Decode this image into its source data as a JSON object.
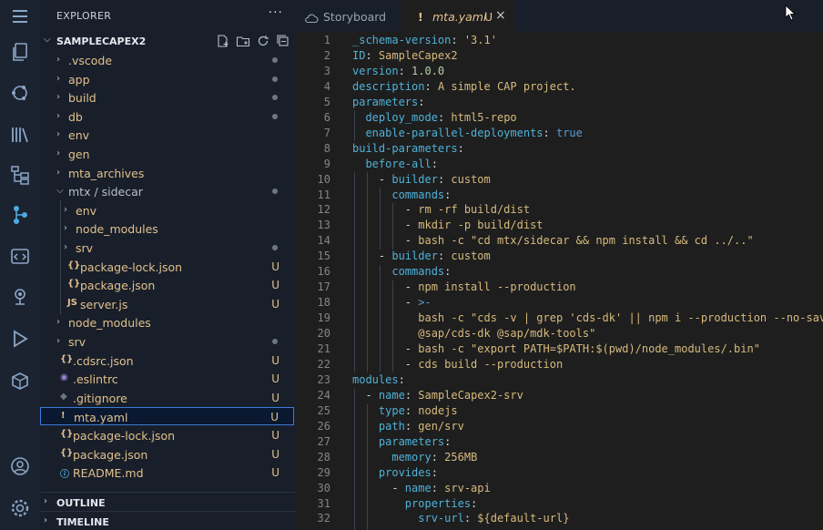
{
  "explorer": {
    "title": "EXPLORER",
    "more": "···",
    "root": "SAMPLECAPEX2",
    "items": [
      {
        "label": ".vscode",
        "type": "folder",
        "depth": 0,
        "open": false,
        "status": "dot",
        "color": "#e2c08d"
      },
      {
        "label": "app",
        "type": "folder",
        "depth": 0,
        "open": false,
        "status": "dot",
        "color": "#e2c08d"
      },
      {
        "label": "build",
        "type": "folder",
        "depth": 0,
        "open": false,
        "status": "dot",
        "color": "#e2c08d"
      },
      {
        "label": "db",
        "type": "folder",
        "depth": 0,
        "open": false,
        "status": "dot",
        "color": "#e2c08d"
      },
      {
        "label": "env",
        "type": "folder",
        "depth": 0,
        "open": false,
        "status": "",
        "color": "#e2c08d"
      },
      {
        "label": "gen",
        "type": "folder",
        "depth": 0,
        "open": false,
        "status": "",
        "color": "#e2c08d"
      },
      {
        "label": "mta_archives",
        "type": "folder",
        "depth": 0,
        "open": false,
        "status": "",
        "color": "#e2c08d"
      },
      {
        "label": "mtx / sidecar",
        "type": "folder",
        "depth": 0,
        "open": true,
        "status": "dot",
        "color": "#b8bfca"
      },
      {
        "label": "env",
        "type": "folder",
        "depth": 1,
        "open": false,
        "status": "",
        "color": "#e2c08d"
      },
      {
        "label": "node_modules",
        "type": "folder",
        "depth": 1,
        "open": false,
        "status": "",
        "color": "#e2c08d"
      },
      {
        "label": "srv",
        "type": "folder",
        "depth": 1,
        "open": false,
        "status": "dot",
        "color": "#e2c08d"
      },
      {
        "label": "package-lock.json",
        "type": "json",
        "depth": 1,
        "icon": "{}",
        "status": "U",
        "color": "#e2c08d"
      },
      {
        "label": "package.json",
        "type": "json",
        "depth": 1,
        "icon": "{}",
        "status": "U",
        "color": "#e2c08d"
      },
      {
        "label": "server.js",
        "type": "js",
        "depth": 1,
        "icon": "JS",
        "status": "U",
        "color": "#e2c08d"
      },
      {
        "label": "node_modules",
        "type": "folder",
        "depth": 0,
        "open": false,
        "status": "",
        "color": "#e2c08d"
      },
      {
        "label": "srv",
        "type": "folder",
        "depth": 0,
        "open": false,
        "status": "dot",
        "color": "#e2c08d"
      },
      {
        "label": ".cdsrc.json",
        "type": "json",
        "depth": 0,
        "icon": "{}",
        "status": "U",
        "color": "#e2c08d"
      },
      {
        "label": ".eslintrc",
        "type": "eslint",
        "depth": 0,
        "icon": "◉",
        "status": "U",
        "color": "#e2c08d"
      },
      {
        "label": ".gitignore",
        "type": "git",
        "depth": 0,
        "icon": "◆",
        "status": "U",
        "color": "#e2c08d"
      },
      {
        "label": "mta.yaml",
        "type": "yaml",
        "depth": 0,
        "icon": "!",
        "status": "U",
        "color": "#e2c08d",
        "selected": true
      },
      {
        "label": "package-lock.json",
        "type": "json",
        "depth": 0,
        "icon": "{}",
        "status": "U",
        "color": "#e2c08d"
      },
      {
        "label": "package.json",
        "type": "json",
        "depth": 0,
        "icon": "{}",
        "status": "U",
        "color": "#e2c08d"
      },
      {
        "label": "README.md",
        "type": "info",
        "depth": 0,
        "icon": "ⓘ",
        "status": "U",
        "color": "#e2c08d"
      }
    ],
    "outline": "OUTLINE",
    "timeline": "TIMELINE"
  },
  "tabs": [
    {
      "label": "Storyboard",
      "active": false,
      "icon": "cloud-icon"
    },
    {
      "label": "mta.yaml",
      "active": true,
      "icon": "!",
      "status": "U",
      "close": "×"
    }
  ],
  "editor": {
    "lines": [
      {
        "n": "1",
        "parts": [
          [
            "k",
            "_schema-version"
          ],
          [
            "p",
            ": "
          ],
          [
            "s",
            "'3.1'"
          ]
        ]
      },
      {
        "n": "2",
        "parts": [
          [
            "k",
            "ID"
          ],
          [
            "p",
            ": "
          ],
          [
            "t",
            "SampleCapex2"
          ]
        ]
      },
      {
        "n": "3",
        "parts": [
          [
            "k",
            "version"
          ],
          [
            "p",
            ": "
          ],
          [
            "n",
            "1.0.0"
          ]
        ]
      },
      {
        "n": "4",
        "parts": [
          [
            "k",
            "description"
          ],
          [
            "p",
            ": "
          ],
          [
            "t",
            "A simple CAP project."
          ]
        ]
      },
      {
        "n": "5",
        "parts": [
          [
            "k",
            "parameters"
          ],
          [
            "p",
            ":"
          ]
        ]
      },
      {
        "n": "6",
        "parts": [
          [
            "p",
            "  "
          ],
          [
            "k",
            "deploy_mode"
          ],
          [
            "p",
            ": "
          ],
          [
            "t",
            "html5-repo"
          ]
        ]
      },
      {
        "n": "7",
        "parts": [
          [
            "p",
            "  "
          ],
          [
            "k",
            "enable-parallel-deployments"
          ],
          [
            "p",
            ": "
          ],
          [
            "b",
            "true"
          ]
        ]
      },
      {
        "n": "8",
        "parts": [
          [
            "k",
            "build-parameters"
          ],
          [
            "p",
            ":"
          ]
        ]
      },
      {
        "n": "9",
        "parts": [
          [
            "p",
            "  "
          ],
          [
            "k",
            "before-all"
          ],
          [
            "p",
            ":"
          ]
        ]
      },
      {
        "n": "10",
        "parts": [
          [
            "p",
            "    - "
          ],
          [
            "k",
            "builder"
          ],
          [
            "p",
            ": "
          ],
          [
            "t",
            "custom"
          ]
        ]
      },
      {
        "n": "11",
        "parts": [
          [
            "p",
            "      "
          ],
          [
            "k",
            "commands"
          ],
          [
            "p",
            ":"
          ]
        ]
      },
      {
        "n": "12",
        "parts": [
          [
            "p",
            "        - "
          ],
          [
            "t",
            "rm -rf build/dist"
          ]
        ]
      },
      {
        "n": "13",
        "parts": [
          [
            "p",
            "        - "
          ],
          [
            "t",
            "mkdir -p build/dist"
          ]
        ]
      },
      {
        "n": "14",
        "parts": [
          [
            "p",
            "        - "
          ],
          [
            "t",
            "bash -c \"cd mtx/sidecar && npm install && cd ../..\""
          ]
        ]
      },
      {
        "n": "15",
        "parts": [
          [
            "p",
            "    - "
          ],
          [
            "k",
            "builder"
          ],
          [
            "p",
            ": "
          ],
          [
            "t",
            "custom"
          ]
        ]
      },
      {
        "n": "16",
        "parts": [
          [
            "p",
            "      "
          ],
          [
            "k",
            "commands"
          ],
          [
            "p",
            ":"
          ]
        ]
      },
      {
        "n": "17",
        "parts": [
          [
            "p",
            "        - "
          ],
          [
            "t",
            "npm install --production"
          ]
        ]
      },
      {
        "n": "18",
        "parts": [
          [
            "p",
            "        - "
          ],
          [
            "b",
            ">-"
          ]
        ]
      },
      {
        "n": "19",
        "parts": [
          [
            "p",
            "          "
          ],
          [
            "t",
            "bash -c \"cds -v | grep 'cds-dk' || npm i --production --no-save"
          ]
        ]
      },
      {
        "n": "20",
        "parts": [
          [
            "p",
            "          "
          ],
          [
            "t",
            "@sap/cds-dk @sap/mdk-tools\""
          ]
        ]
      },
      {
        "n": "21",
        "parts": [
          [
            "p",
            "        - "
          ],
          [
            "t",
            "bash -c \"export PATH=$PATH:$(pwd)/node_modules/.bin\""
          ]
        ]
      },
      {
        "n": "22",
        "parts": [
          [
            "p",
            "        - "
          ],
          [
            "t",
            "cds build --production"
          ]
        ]
      },
      {
        "n": "23",
        "parts": [
          [
            "k",
            "modules"
          ],
          [
            "p",
            ":"
          ]
        ]
      },
      {
        "n": "24",
        "parts": [
          [
            "p",
            "  - "
          ],
          [
            "k",
            "name"
          ],
          [
            "p",
            ": "
          ],
          [
            "t",
            "SampleCapex2-srv"
          ]
        ]
      },
      {
        "n": "25",
        "parts": [
          [
            "p",
            "    "
          ],
          [
            "k",
            "type"
          ],
          [
            "p",
            ": "
          ],
          [
            "t",
            "nodejs"
          ]
        ]
      },
      {
        "n": "26",
        "parts": [
          [
            "p",
            "    "
          ],
          [
            "k",
            "path"
          ],
          [
            "p",
            ": "
          ],
          [
            "t",
            "gen/srv"
          ]
        ]
      },
      {
        "n": "27",
        "parts": [
          [
            "p",
            "    "
          ],
          [
            "k",
            "parameters"
          ],
          [
            "p",
            ":"
          ]
        ]
      },
      {
        "n": "28",
        "parts": [
          [
            "p",
            "      "
          ],
          [
            "k",
            "memory"
          ],
          [
            "p",
            ": "
          ],
          [
            "t",
            "256MB"
          ]
        ]
      },
      {
        "n": "29",
        "parts": [
          [
            "p",
            "    "
          ],
          [
            "k",
            "provides"
          ],
          [
            "p",
            ":"
          ]
        ]
      },
      {
        "n": "30",
        "parts": [
          [
            "p",
            "      - "
          ],
          [
            "k",
            "name"
          ],
          [
            "p",
            ": "
          ],
          [
            "t",
            "srv-api"
          ]
        ]
      },
      {
        "n": "31",
        "parts": [
          [
            "p",
            "        "
          ],
          [
            "k",
            "properties"
          ],
          [
            "p",
            ":"
          ]
        ]
      },
      {
        "n": "32",
        "parts": [
          [
            "p",
            "          "
          ],
          [
            "k",
            "srv-url"
          ],
          [
            "p",
            ": "
          ],
          [
            "t",
            "${default-url}"
          ]
        ]
      }
    ]
  },
  "activity": [
    "menu-icon",
    "files-icon",
    "source-control-icon",
    "library-icon",
    "hierarchy-icon",
    "graph-icon",
    "code-icon",
    "deploy-icon",
    "run-icon",
    "extensions-icon",
    "account-icon",
    "settings-icon"
  ]
}
